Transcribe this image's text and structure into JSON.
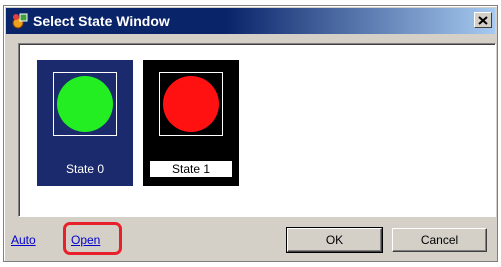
{
  "window": {
    "title": "Select State Window",
    "title_bar_color": "#0a246a"
  },
  "states": [
    {
      "label": "State 0",
      "lamp_color": "#22ee22",
      "selected": true
    },
    {
      "label": "State 1",
      "lamp_color": "#ff1111",
      "selected": false
    }
  ],
  "links": {
    "auto_label": "Auto",
    "open_label": "Open"
  },
  "buttons": {
    "ok_label": "OK",
    "cancel_label": "Cancel"
  },
  "annotation": {
    "highlight_color": "#e8202a"
  }
}
